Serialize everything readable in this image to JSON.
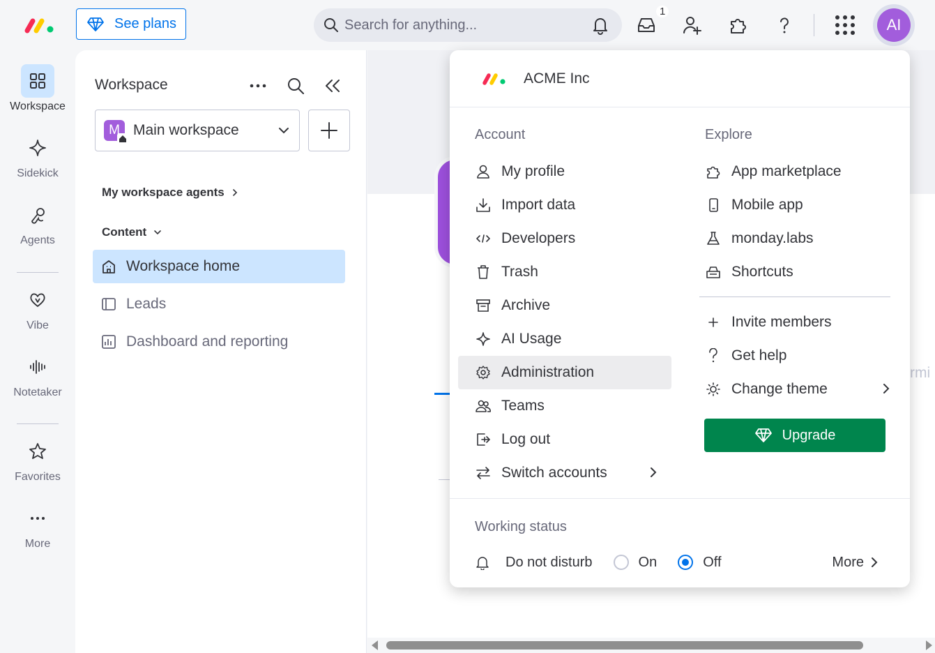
{
  "topbar": {
    "see_plans_label": "See plans",
    "search_placeholder": "Search for anything...",
    "inbox_badge": "1",
    "avatar_initials": "AI"
  },
  "rail": {
    "items": [
      {
        "label": "Workspace",
        "icon": "grid-icon"
      },
      {
        "label": "Sidekick",
        "icon": "sparkle-icon"
      },
      {
        "label": "Agents",
        "icon": "agent-icon"
      },
      {
        "label": "Vibe",
        "icon": "heart-icon"
      },
      {
        "label": "Notetaker",
        "icon": "waveform-icon"
      },
      {
        "label": "Favorites",
        "icon": "star-icon"
      },
      {
        "label": "More",
        "icon": "ellipsis-icon"
      }
    ]
  },
  "workspace": {
    "title": "Workspace",
    "selector_label": "Main workspace",
    "selector_badge": "M",
    "agents_section": "My workspace agents",
    "content_section": "Content",
    "items": [
      {
        "label": "Workspace home"
      },
      {
        "label": "Leads"
      },
      {
        "label": "Dashboard and reporting"
      }
    ]
  },
  "main": {
    "peek_text": "rmi"
  },
  "menu": {
    "org_name": "ACME Inc",
    "account_title": "Account",
    "explore_title": "Explore",
    "account_items": [
      {
        "label": "My profile",
        "icon": "person-icon"
      },
      {
        "label": "Import data",
        "icon": "download-icon"
      },
      {
        "label": "Developers",
        "icon": "code-icon"
      },
      {
        "label": "Trash",
        "icon": "trash-icon"
      },
      {
        "label": "Archive",
        "icon": "archive-icon"
      },
      {
        "label": "AI Usage",
        "icon": "sparkle-icon"
      },
      {
        "label": "Administration",
        "icon": "gear-icon"
      },
      {
        "label": "Teams",
        "icon": "team-icon"
      },
      {
        "label": "Log out",
        "icon": "logout-icon"
      },
      {
        "label": "Switch accounts",
        "icon": "switch-icon"
      }
    ],
    "explore_items": [
      {
        "label": "App marketplace",
        "icon": "puzzle-icon"
      },
      {
        "label": "Mobile app",
        "icon": "mobile-icon"
      },
      {
        "label": "monday.labs",
        "icon": "flask-icon"
      },
      {
        "label": "Shortcuts",
        "icon": "keyboard-icon"
      }
    ],
    "extra_items": [
      {
        "label": "Invite members",
        "icon": "plus-icon"
      },
      {
        "label": "Get help",
        "icon": "question-icon"
      },
      {
        "label": "Change theme",
        "icon": "sun-icon"
      }
    ],
    "upgrade_label": "Upgrade",
    "working_status_title": "Working status",
    "dnd_label": "Do not disturb",
    "on_label": "On",
    "off_label": "Off",
    "dnd_selected": "Off",
    "more_label": "More"
  },
  "colors": {
    "primary": "#0073ea",
    "upgrade": "#00854d",
    "avatar": "#a25ddc",
    "active_bg": "#cce5ff"
  }
}
